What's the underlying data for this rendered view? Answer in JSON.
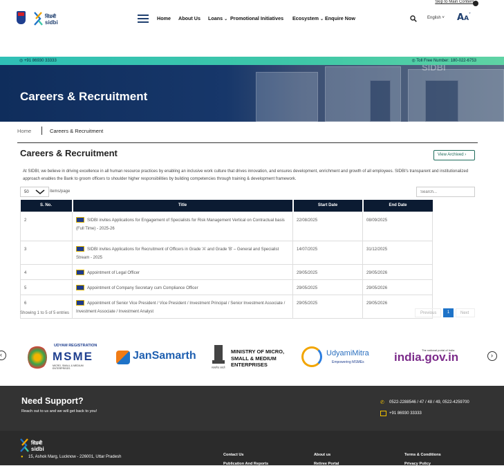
{
  "topbar": {
    "skip_link": "Skip to Main Content"
  },
  "header": {
    "brand_text": "sidbi",
    "nav": [
      "Home",
      "About Us",
      "Loans",
      "Promotional Initiatives",
      "Ecosystem",
      "Enquire Now"
    ],
    "language": "English",
    "font_size_label": "A"
  },
  "contact_bar": {
    "phone": "+91 86930 33333",
    "toll_free": "Toll Free Number: 180-022-6753"
  },
  "banner": {
    "title": "Careers & Recruitment",
    "watermark": "SIDBI"
  },
  "breadcrumb": {
    "home": "Home",
    "current": "Careers & Recruitment"
  },
  "main": {
    "title": "Careers & Recruitment",
    "view_archived": "View Archived",
    "intro": "At SIDBI, we believe in driving excellence in all human resource practices by enabling an inclusive work culture that drives innovation, and ensures development, enrichment and growth of all employees. SIDBI's transparent and institutionalized approach enables the Bank to groom officers to shoulder higher responsibilities by building competencies through training & development framework.",
    "per_page": "50",
    "per_page_label": "items/page",
    "search_placeholder": "Search..."
  },
  "table": {
    "columns": [
      "S. No.",
      "Title",
      "Start Date",
      "End Date"
    ],
    "rows": [
      {
        "sno": "2",
        "title": "SIDBI invites Applications for Engagement of Specialists for Risk Management Vertical on Contractual basis (Full Time) - 2025-26",
        "start": "22/08/2025",
        "end": "08/09/2025"
      },
      {
        "sno": "3",
        "title": "SIDBI invites Applications for Recruitment of Officers in Grade 'A' and Grade 'B' – General and Specialist Stream - 2025",
        "start": "14/07/2025",
        "end": "31/12/2025"
      },
      {
        "sno": "4",
        "title": "Appointment of Legal Officer",
        "start": "29/05/2025",
        "end": "29/05/2026"
      },
      {
        "sno": "5",
        "title": "Appointment of Company Secretary cum Compliance Officer",
        "start": "29/05/2025",
        "end": "29/05/2026"
      },
      {
        "sno": "6",
        "title": "Appointment of Senior Vice President / Vice President / Investment Principal / Senior Investment Associate / Investment Associate / Investment Analyst",
        "start": "29/05/2025",
        "end": "29/05/2026"
      }
    ]
  },
  "pagination": {
    "showing": "Showing 1 to 5 of 5 entries",
    "prev": "Previous",
    "current": "1",
    "next": "Next"
  },
  "partners": {
    "udyam_top": "UDYAM REGISTRATION",
    "udyam_main": "MSME",
    "udyam_sub": "MICRO, SMALL & MEDIUM ENTERPRISES",
    "jansamarth": "JanSamarth",
    "ministry": [
      "MINISTRY OF MICRO,",
      "SMALL & MEDIUM",
      "ENTERPRISES"
    ],
    "udyami_mitra": "UdyamiMitra",
    "udyami_mitra_sub": "Empowering MSMEs",
    "india_top": "The national portal of India",
    "india": "india.gov.in"
  },
  "support": {
    "title": "Need Support?",
    "subtitle": "Reach out to us and we will get back to you!",
    "phones": "0522-2288546 / 47 / 48 / 49, 0522-4259700",
    "mobile": "+91 86930 33333"
  },
  "footer": {
    "address": "15, Ashok Marg, Lucknow - 226001, Uttar Pradesh",
    "col1": [
      "Contact Us",
      "Publication And Reports"
    ],
    "col2": [
      "About us",
      "Retiree Portal"
    ],
    "col3": [
      "Terms & Conditions",
      "Privacy Policy"
    ]
  },
  "colors": {
    "navy": "#0b1b32",
    "teal": "#3ec7a7",
    "accent_green": "#1d6b5a",
    "page_blue": "#1e73c8",
    "footer": "#333333"
  }
}
